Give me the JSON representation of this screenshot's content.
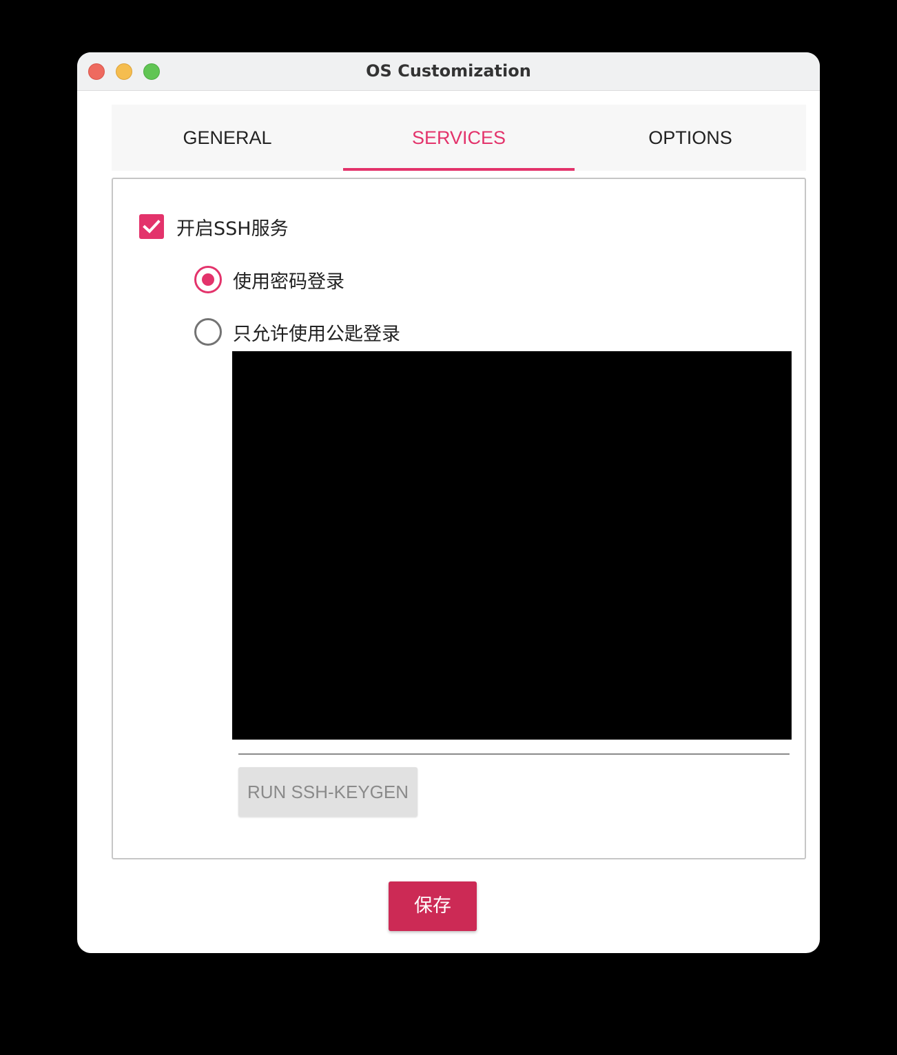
{
  "window": {
    "title": "OS Customization"
  },
  "tabs": [
    {
      "label": "GENERAL",
      "active": false
    },
    {
      "label": "SERVICES",
      "active": true
    },
    {
      "label": "OPTIONS",
      "active": false
    }
  ],
  "ssh": {
    "enable_label": "开启SSH服务",
    "enabled": true,
    "password_login_label": "使用密码登录",
    "password_login_selected": true,
    "pubkey_only_label": "只允许使用公匙登录",
    "pubkey_only_selected": false,
    "keygen_button_label": "RUN SSH-KEYGEN"
  },
  "footer": {
    "save_label": "保存"
  },
  "colors": {
    "accent": "#e3336b",
    "save_button": "#cc2a55",
    "close": "#ee6a5f",
    "minimize": "#f5bd4f",
    "maximize": "#61c554"
  }
}
